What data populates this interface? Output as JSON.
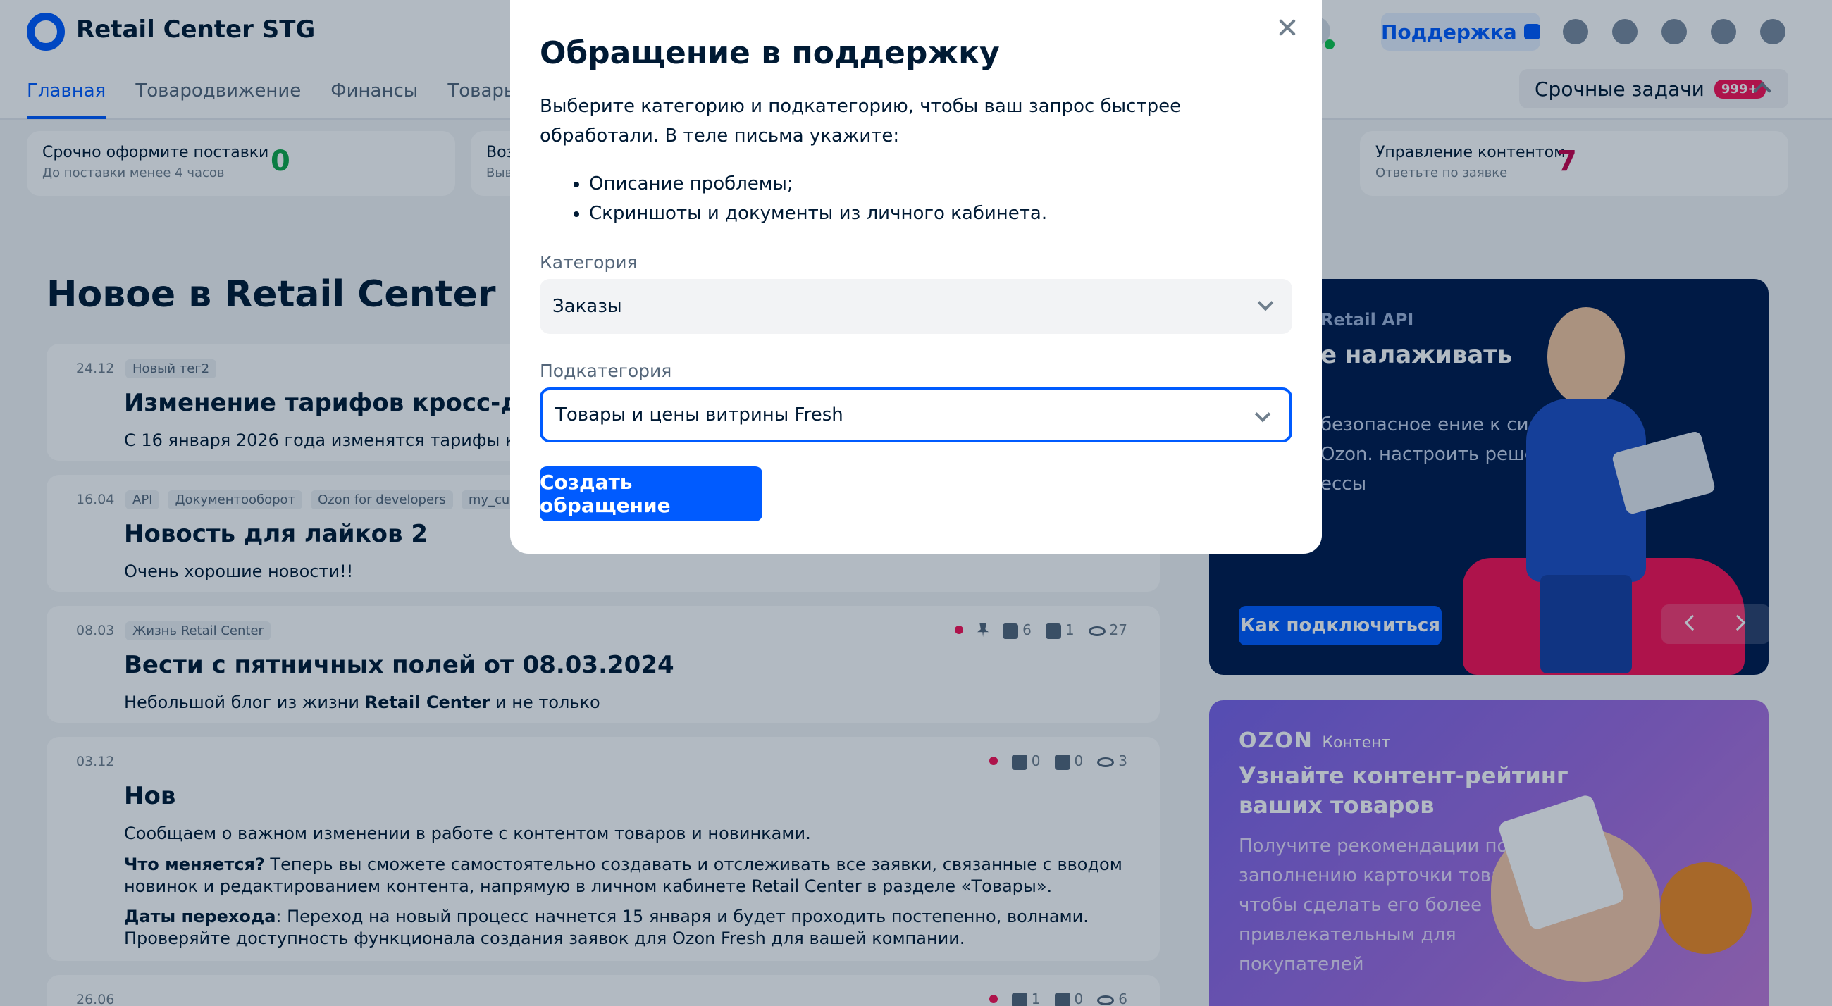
{
  "header": {
    "app_title": "Retail Center STG",
    "support_label": "Поддержка",
    "nav": [
      "Главная",
      "Товародвижение",
      "Финансы",
      "Товары"
    ],
    "urgent_label": "Срочные задачи",
    "urgent_badge": "999+"
  },
  "cards": [
    {
      "title": "Срочно оформите поставки",
      "subtitle": "До поставки менее 4 часов",
      "value": "0",
      "value_color": "#10a84a"
    },
    {
      "title": "Воз",
      "subtitle": "Выв",
      "value": ""
    },
    {
      "title": "Управление контентом",
      "subtitle": "Ответьте по заявке",
      "value": "7",
      "value_color": "#c8004b"
    }
  ],
  "news_section": {
    "title": "Новое в Retail Center",
    "items": [
      {
        "date": "24.12",
        "tags": [
          "Новый тег2"
        ],
        "title": "Изменение тарифов кросс-докин",
        "text": "С 16 января 2026 года изменятся тарифы крос"
      },
      {
        "date": "16.04",
        "tags": [
          "API",
          "Документооборот",
          "Ozon for developers",
          "my_cus"
        ],
        "title": "Новость для лайков 2",
        "text": "Очень хорошие новости!!"
      },
      {
        "date": "08.03",
        "tags": [
          "Жизнь Retail Center"
        ],
        "title": "Вести с пятничных полей от 08.03.2024",
        "text_prefix": "Небольшой блог из жизни ",
        "text_bold": "Retail Center",
        "text_suffix": " и не только",
        "likes": "6",
        "dislikes": "1",
        "views": "27"
      },
      {
        "date": "03.12",
        "tags": [],
        "title": "Нов",
        "text": "Сообщаем о важном изменении в работе с контентом товаров и новинками.",
        "p2_bold": "Что меняется?",
        "p2": " Теперь вы сможете самостоятельно создавать и отслеживать все заявки, связанные с вводом новинок и редактированием контента, напрямую в личном кабинете Retail Center в разделе «Товары».",
        "p3_bold": "Даты перехода",
        "p3": ": Переход на новый процесс начнется 15 января и будет проходить постепенно, волнами. Проверяйте доступность функционала создания заявок для Ozon Fresh для вашей компании.",
        "likes": "0",
        "dislikes": "0",
        "views": "3"
      },
      {
        "date": "26.06",
        "likes": "1",
        "dislikes": "0",
        "views": "6"
      }
    ]
  },
  "banner_api": {
    "label": "Retail API",
    "title": "е налаживать",
    "text": "безопасное ение к системам Ozon. настроить решение ессы",
    "cta": "Как подключиться"
  },
  "banner_content": {
    "brand": "OZON",
    "brand_sub": "Контент",
    "title": "Узнайте контент-рейтинг ваших товаров",
    "text": "Получите рекомендации по заполнению карточки товара, чтобы сделать его более привлекательным для покупателей"
  },
  "modal": {
    "title": "Обращение в поддержку",
    "description": "Выберите категорию и подкатегорию, чтобы ваш запрос быстрее обработали. В теле письма укажите:",
    "bullets": [
      "Описание проблемы;",
      "Скриншоты и документы из личного кабинета."
    ],
    "category_label": "Категория",
    "category_value": "Заказы",
    "subcategory_label": "Подкатегория",
    "subcategory_value": "Товары и цены витрины Fresh",
    "submit_label": "Создать обращение"
  },
  "colors": {
    "accent": "#005bff",
    "alert": "#f91155"
  }
}
